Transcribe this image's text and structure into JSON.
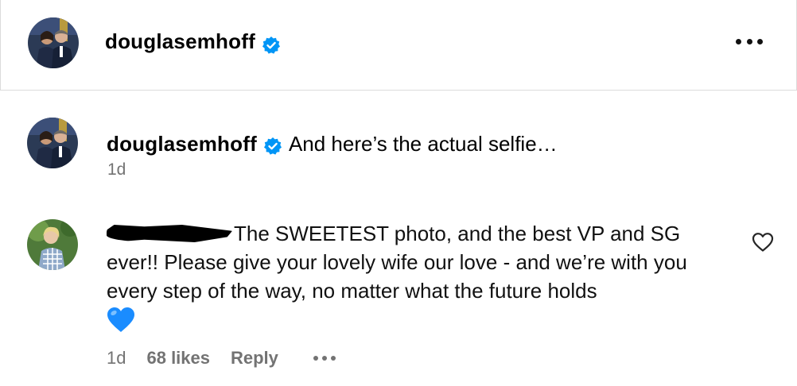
{
  "header": {
    "username": "douglasemhoff"
  },
  "caption": {
    "username": "douglasemhoff",
    "text": "And here’s the actual selfie…",
    "time": "1d"
  },
  "comment": {
    "text_line1": "The SWEETEST photo, and the best VP and SG",
    "text_rest": "ever!! Please give your lovely wife our love - and we’re with you every step of the way, no matter what the future holds",
    "emoji": "💙",
    "time": "1d",
    "likes": "68 likes",
    "reply_label": "Reply"
  },
  "colors": {
    "verified_blue": "#0095f6",
    "muted_text": "#737373",
    "border": "#dbdbdb",
    "heart_emoji": "#1a8cff"
  },
  "icons": {
    "verified": "verified-badge-icon",
    "more": "more-options-icon",
    "like": "heart-outline-icon"
  }
}
